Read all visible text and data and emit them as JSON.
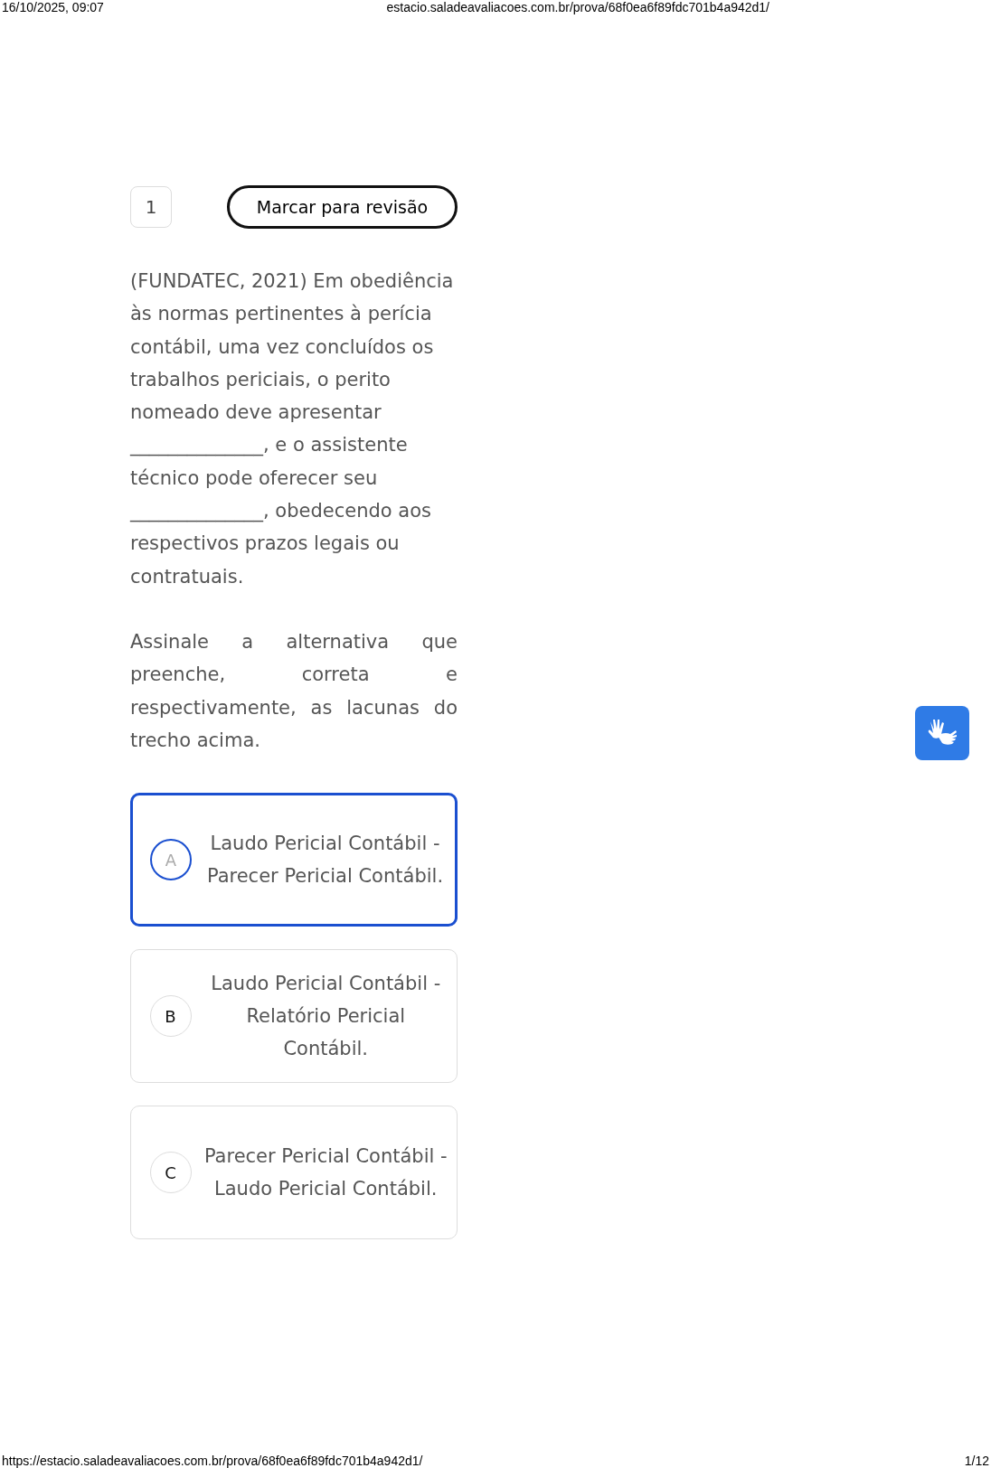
{
  "print_header": {
    "date": "16/10/2025, 09:07",
    "url": "estacio.saladeavaliacoes.com.br/prova/68f0ea6f89fdc701b4a942d1/"
  },
  "question": {
    "number": "1",
    "review_button": "Marcar para revisão",
    "paragraphs": [
      "(FUNDATEC, 2021) Em obediência às normas pertinentes à perícia contábil, uma vez concluídos os trabalhos periciais, o perito nomeado deve apresentar ______________, e o assistente técnico pode oferecer seu ______________, obedecendo aos respectivos prazos legais ou contratuais.",
      "Assinale a alternativa que preenche, correta e respectivamente, as lacunas do trecho acima."
    ],
    "options": [
      {
        "letter": "A",
        "text": "Laudo Pericial Contábil - Parecer Pericial Contábil.",
        "selected": true
      },
      {
        "letter": "B",
        "text": "Laudo Pericial Contábil - Relatório Pericial Contábil.",
        "selected": false
      },
      {
        "letter": "C",
        "text": "Parecer Pericial Contábil - Laudo Pericial Contábil.",
        "selected": false
      }
    ]
  },
  "print_footer": {
    "url": "https://estacio.saladeavaliacoes.com.br/prova/68f0ea6f89fdc701b4a942d1/",
    "page": "1/12"
  }
}
